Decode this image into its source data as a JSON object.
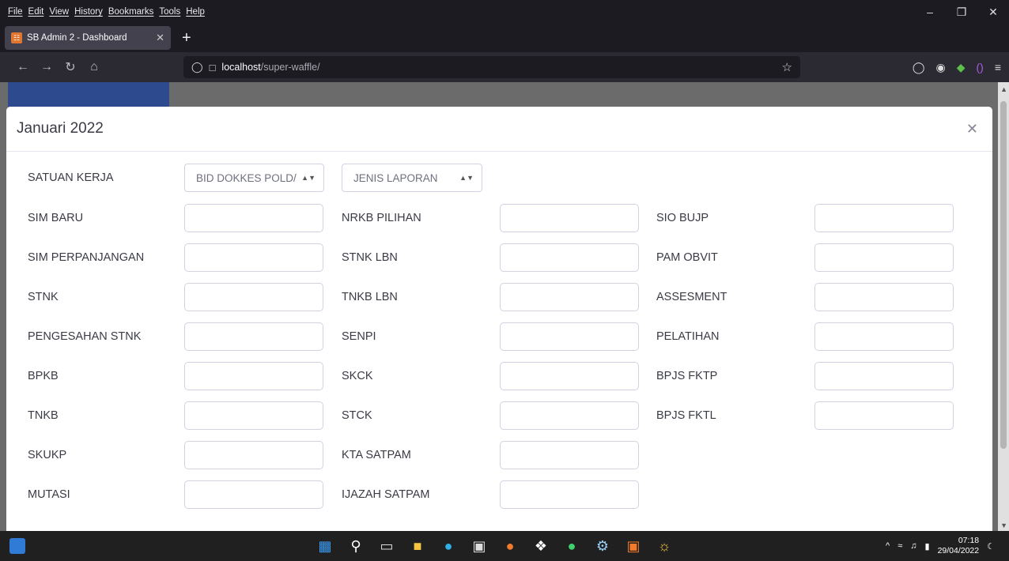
{
  "browser": {
    "menu": [
      "File",
      "Edit",
      "View",
      "History",
      "Bookmarks",
      "Tools",
      "Help"
    ],
    "tab_title": "SB Admin 2 - Dashboard",
    "url_host": "localhost",
    "url_path": "/super-waffle/"
  },
  "modal": {
    "title": "Januari 2022",
    "filter_label": "SATUAN KERJA",
    "unit_select": "BID DOKKES POLD/",
    "report_select": "JENIS LAPORAN"
  },
  "fields": {
    "col1": [
      "SIM BARU",
      "SIM PERPANJANGAN",
      "STNK",
      "PENGESAHAN STNK",
      "BPKB",
      "TNKB",
      "SKUKP",
      "MUTASI"
    ],
    "col2": [
      "NRKB PILIHAN",
      "STNK LBN",
      "TNKB LBN",
      "SENPI",
      "SKCK",
      "STCK",
      "KTA SATPAM",
      "IJAZAH SATPAM"
    ],
    "col3": [
      "SIO BUJP",
      "PAM OBVIT",
      "ASSESMENT",
      "PELATIHAN",
      "BPJS FKTP",
      "BPJS FKTL"
    ]
  },
  "taskbar": {
    "time": "07:18",
    "date": "29/04/2022"
  },
  "colors": {
    "accent": "#4e73df",
    "browser_bg": "#1c1b22",
    "overlay": "#6b6b6b"
  }
}
